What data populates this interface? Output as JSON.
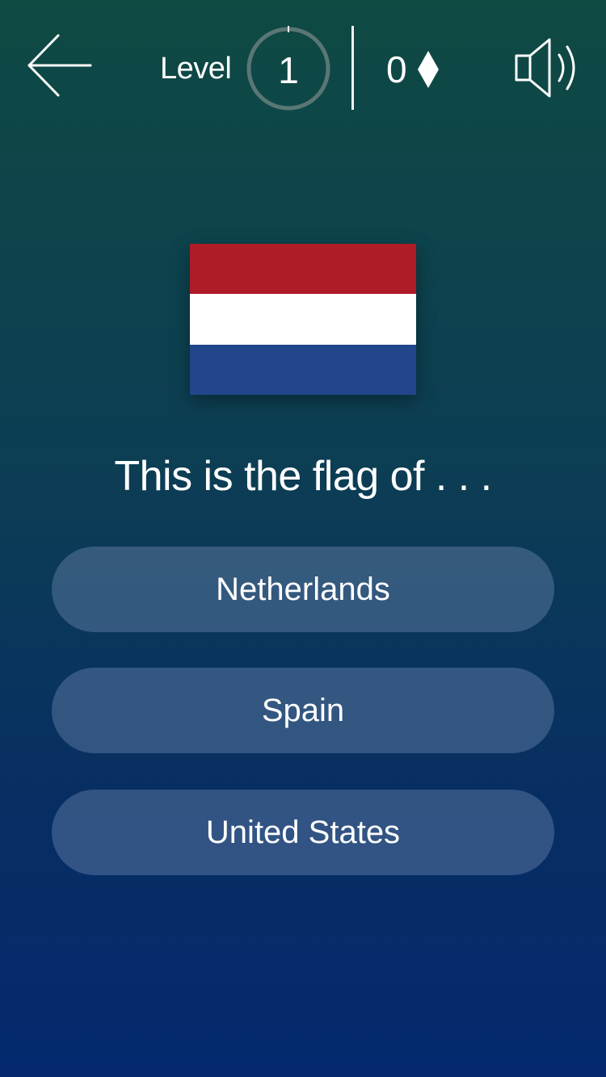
{
  "header": {
    "back_icon": "arrow-left-icon",
    "level_label": "Level",
    "level_number": "1",
    "level_progress": 0,
    "gem_count": "0",
    "gem_icon": "diamond-icon",
    "sound_icon": "speaker-volume-icon"
  },
  "flag": {
    "stripes": [
      "#ae1c28",
      "#ffffff",
      "#21468b"
    ]
  },
  "question": {
    "text": "This is the flag of . . ."
  },
  "answers": [
    {
      "label": "Netherlands"
    },
    {
      "label": "Spain"
    },
    {
      "label": "United States"
    }
  ],
  "colors": {
    "background_top": "#0f4a43",
    "background_bottom": "#04296f",
    "button_fill": "#4f6b94",
    "text": "#ffffff"
  }
}
